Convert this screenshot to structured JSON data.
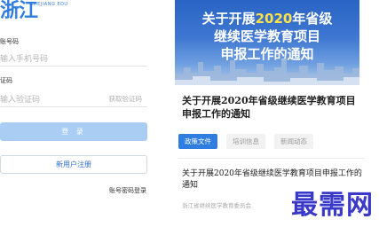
{
  "login": {
    "logo_text": "浙江",
    "logo_subtext": "ZHEJIANG EDU",
    "phone_label": "账号码",
    "phone_placeholder": "输入手机号码",
    "code_label": "证码",
    "code_placeholder": "输入验证码",
    "get_code_label": "获取验证码",
    "login_button": "登 录",
    "register_button": "新用户注册",
    "password_login_link": "账号密码登录"
  },
  "article": {
    "banner_line1_pre": "关于开展",
    "banner_year": "2020",
    "banner_line1_post": "年省级",
    "banner_line2": "继续医学教育项目",
    "banner_line3": "申报工作的通知",
    "title": "关于开展2020年省级继续医学教育项目申报工作的通知",
    "tabs": [
      {
        "label": "政策文件",
        "active": true
      },
      {
        "label": "培训信息",
        "active": false
      },
      {
        "label": "新闻动态",
        "active": false
      }
    ],
    "news_title": "关于开展2020年省级继续医学教育项目申报工作的通知",
    "news_source": "浙江省继续医学教育委员会"
  },
  "watermark": "最需网",
  "colors": {
    "accent": "#2f7de1",
    "login_button_bg": "#a9cdf3",
    "banner_year": "#ffe24a",
    "watermark": "#3a38c8"
  }
}
